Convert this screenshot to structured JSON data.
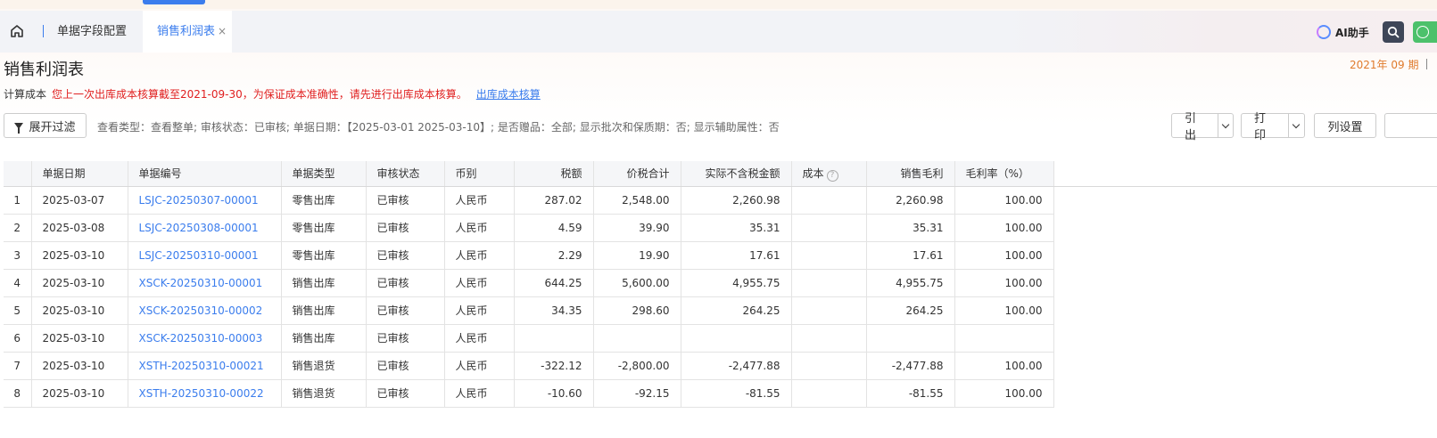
{
  "tabs": {
    "home_icon": "home-icon",
    "items": [
      {
        "label": "单据字段配置"
      },
      {
        "label": "销售利润表",
        "close": "×"
      }
    ]
  },
  "header_right": {
    "ai_label": "AI助手"
  },
  "page": {
    "title": "销售利润表",
    "period": "2021年 09 期"
  },
  "notice": {
    "prefix": "计算成本",
    "warning": "您上一次出库成本核算截至2021-09-30，为保证成本准确性，请先进行出库成本核算。",
    "link": "出库成本核算"
  },
  "toolbar": {
    "filter_label": "展开过滤",
    "filter_summary": "查看类型：查看整单; 审核状态：已审核; 单据日期：【2025-03-01 2025-03-10】; 是否赠品：全部; 显示批次和保质期：否; 显示辅助属性：否",
    "export_label": "引出",
    "print_label": "打印",
    "columns_label": "列设置"
  },
  "table": {
    "headers": [
      "",
      "单据日期",
      "单据编号",
      "单据类型",
      "审核状态",
      "币别",
      "税额",
      "价税合计",
      "实际不含税金额",
      "成本",
      "销售毛利",
      "毛利率（%）"
    ],
    "rows": [
      [
        "1",
        "2025-03-07",
        "LSJC-20250307-00001",
        "零售出库",
        "已审核",
        "人民币",
        "287.02",
        "2,548.00",
        "2,260.98",
        "",
        "2,260.98",
        "100.00"
      ],
      [
        "2",
        "2025-03-08",
        "LSJC-20250308-00001",
        "零售出库",
        "已审核",
        "人民币",
        "4.59",
        "39.90",
        "35.31",
        "",
        "35.31",
        "100.00"
      ],
      [
        "3",
        "2025-03-10",
        "LSJC-20250310-00001",
        "零售出库",
        "已审核",
        "人民币",
        "2.29",
        "19.90",
        "17.61",
        "",
        "17.61",
        "100.00"
      ],
      [
        "4",
        "2025-03-10",
        "XSCK-20250310-00001",
        "销售出库",
        "已审核",
        "人民币",
        "644.25",
        "5,600.00",
        "4,955.75",
        "",
        "4,955.75",
        "100.00"
      ],
      [
        "5",
        "2025-03-10",
        "XSCK-20250310-00002",
        "销售出库",
        "已审核",
        "人民币",
        "34.35",
        "298.60",
        "264.25",
        "",
        "264.25",
        "100.00"
      ],
      [
        "6",
        "2025-03-10",
        "XSCK-20250310-00003",
        "销售出库",
        "已审核",
        "人民币",
        "",
        "",
        "",
        "",
        "",
        ""
      ],
      [
        "7",
        "2025-03-10",
        "XSTH-20250310-00021",
        "销售退货",
        "已审核",
        "人民币",
        "-322.12",
        "-2,800.00",
        "-2,477.88",
        "",
        "-2,477.88",
        "100.00"
      ],
      [
        "8",
        "2025-03-10",
        "XSTH-20250310-00022",
        "销售退货",
        "已审核",
        "人民币",
        "-10.60",
        "-92.15",
        "-81.55",
        "",
        "-81.55",
        "100.00"
      ]
    ]
  },
  "colors": {
    "accent": "#3b7ded",
    "warning": "#e02020",
    "period": "#e07b2d",
    "green": "#4cc16b"
  }
}
